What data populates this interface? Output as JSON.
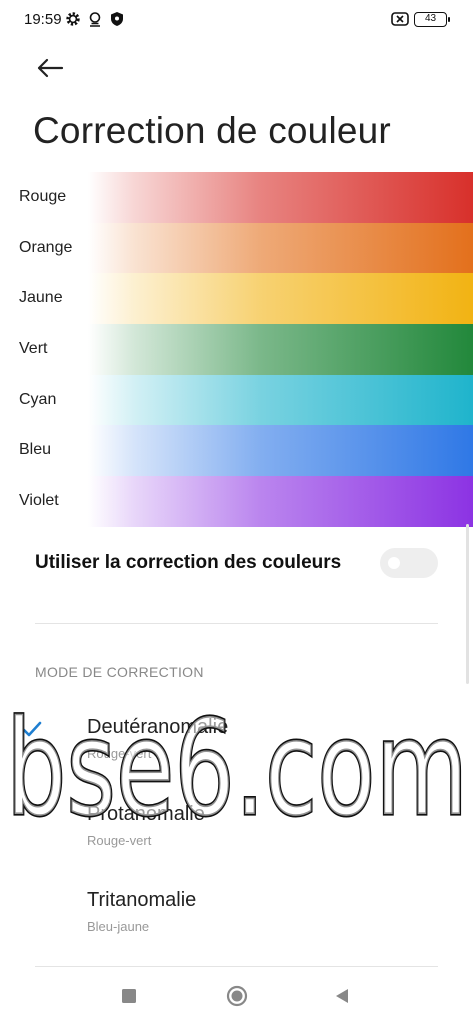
{
  "status_bar": {
    "time": "19:59",
    "battery": "43",
    "icons": [
      "gear-icon",
      "location-icon",
      "shield-icon",
      "sim-off-icon",
      "battery-icon"
    ]
  },
  "header": {
    "back_icon": "arrow-left-icon",
    "title": "Correction de couleur"
  },
  "color_preview": {
    "rows": [
      {
        "label": "Rouge",
        "color": "#d8302b"
      },
      {
        "label": "Orange",
        "color": "#e3701c"
      },
      {
        "label": "Jaune",
        "color": "#f2b313"
      },
      {
        "label": "Vert",
        "color": "#22883b"
      },
      {
        "label": "Cyan",
        "color": "#1fb4cc"
      },
      {
        "label": "Bleu",
        "color": "#2f78e6"
      },
      {
        "label": "Violet",
        "color": "#8c33e3"
      }
    ]
  },
  "toggle": {
    "label": "Utiliser la correction des couleurs",
    "state": "off"
  },
  "section": {
    "header": "MODE DE CORRECTION"
  },
  "options": [
    {
      "title": "Deutéranomalie",
      "subtitle": "Rouge-vert",
      "selected": true
    },
    {
      "title": "Protanomalie",
      "subtitle": "Rouge-vert",
      "selected": false
    },
    {
      "title": "Tritanomalie",
      "subtitle": "Bleu-jaune",
      "selected": false
    }
  ],
  "watermark": {
    "text": "bse6.com"
  },
  "nav_bar": {
    "icons": [
      "recents-square-icon",
      "home-circle-icon",
      "back-triangle-icon"
    ]
  },
  "colors": {
    "accent_check": "#1f7fd1",
    "toggle_off": "#eeeeee"
  }
}
